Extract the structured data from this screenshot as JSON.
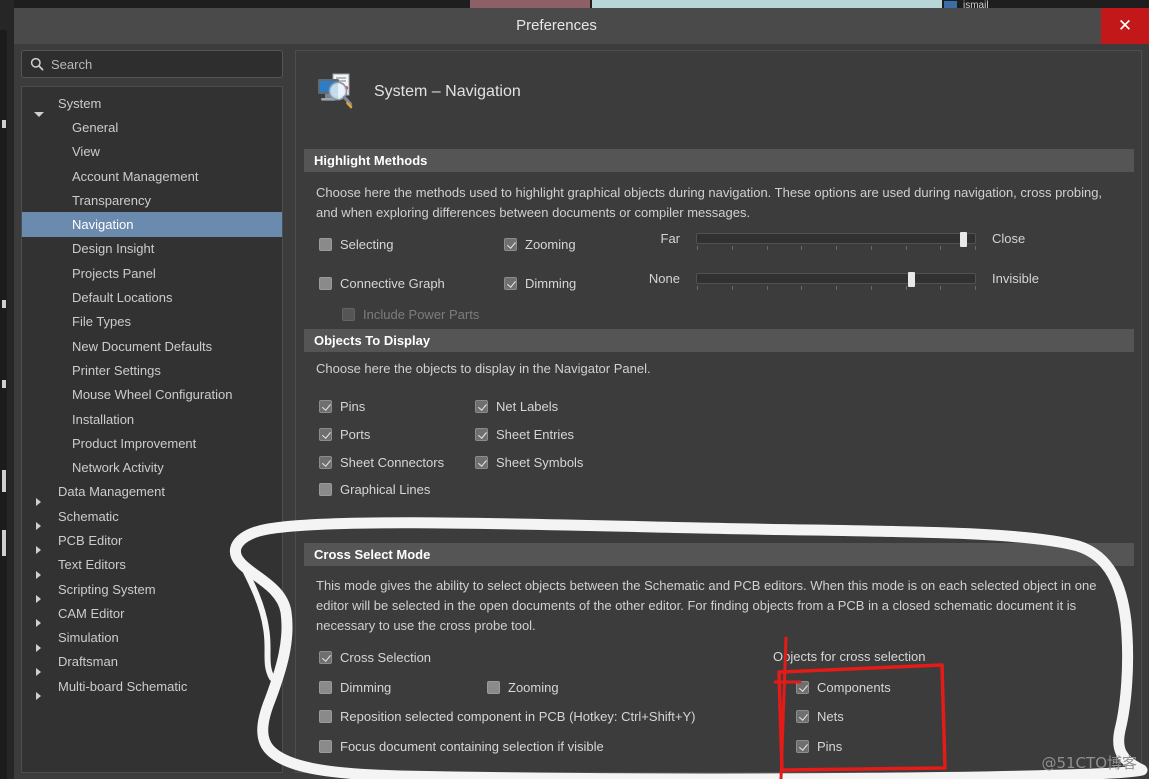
{
  "window": {
    "title": "Preferences",
    "close_label": "✕",
    "close_color": "#c2181a",
    "background_app_text": "ismail"
  },
  "search": {
    "icon": "search-icon",
    "placeholder": "Search",
    "value": ""
  },
  "sidebar": {
    "items": [
      {
        "label": "System",
        "level": 0,
        "expanded": true,
        "selected": false
      },
      {
        "label": "General",
        "level": 1,
        "expanded": false,
        "selected": false
      },
      {
        "label": "View",
        "level": 1,
        "expanded": false,
        "selected": false
      },
      {
        "label": "Account Management",
        "level": 1,
        "expanded": false,
        "selected": false
      },
      {
        "label": "Transparency",
        "level": 1,
        "expanded": false,
        "selected": false
      },
      {
        "label": "Navigation",
        "level": 1,
        "expanded": false,
        "selected": true
      },
      {
        "label": "Design Insight",
        "level": 1,
        "expanded": false,
        "selected": false
      },
      {
        "label": "Projects Panel",
        "level": 1,
        "expanded": false,
        "selected": false
      },
      {
        "label": "Default Locations",
        "level": 1,
        "expanded": false,
        "selected": false
      },
      {
        "label": "File Types",
        "level": 1,
        "expanded": false,
        "selected": false
      },
      {
        "label": "New Document Defaults",
        "level": 1,
        "expanded": false,
        "selected": false
      },
      {
        "label": "Printer Settings",
        "level": 1,
        "expanded": false,
        "selected": false
      },
      {
        "label": "Mouse Wheel Configuration",
        "level": 1,
        "expanded": false,
        "selected": false
      },
      {
        "label": "Installation",
        "level": 1,
        "expanded": false,
        "selected": false
      },
      {
        "label": "Product Improvement",
        "level": 1,
        "expanded": false,
        "selected": false
      },
      {
        "label": "Network Activity",
        "level": 1,
        "expanded": false,
        "selected": false
      },
      {
        "label": "Data Management",
        "level": 0,
        "expanded": false,
        "selected": false
      },
      {
        "label": "Schematic",
        "level": 0,
        "expanded": false,
        "selected": false
      },
      {
        "label": "PCB Editor",
        "level": 0,
        "expanded": false,
        "selected": false
      },
      {
        "label": "Text Editors",
        "level": 0,
        "expanded": false,
        "selected": false
      },
      {
        "label": "Scripting System",
        "level": 0,
        "expanded": false,
        "selected": false
      },
      {
        "label": "CAM Editor",
        "level": 0,
        "expanded": false,
        "selected": false
      },
      {
        "label": "Simulation",
        "level": 0,
        "expanded": false,
        "selected": false
      },
      {
        "label": "Draftsman",
        "level": 0,
        "expanded": false,
        "selected": false
      },
      {
        "label": "Multi-board Schematic",
        "level": 0,
        "expanded": false,
        "selected": false
      }
    ]
  },
  "page": {
    "icon": "system-navigation-icon",
    "title": "System – Navigation"
  },
  "highlight_methods": {
    "header": "Highlight Methods",
    "description": "Choose here the methods used to highlight graphical objects during navigation. These options are used during navigation, cross probing, and when exploring differences between documents or compiler messages.",
    "checkboxes": [
      {
        "label": "Selecting",
        "checked": false,
        "disabled": false
      },
      {
        "label": "Zooming",
        "checked": true,
        "disabled": false
      },
      {
        "label": "Connective Graph",
        "checked": false,
        "disabled": false
      },
      {
        "label": "Dimming",
        "checked": true,
        "disabled": false
      },
      {
        "label": "Include Power Parts",
        "checked": false,
        "disabled": true
      }
    ],
    "sliders": [
      {
        "name": "zoom-slider",
        "left_label": "Far",
        "right_label": "Close",
        "value_pct": 97,
        "ticks": 9
      },
      {
        "name": "dimming-slider",
        "left_label": "None",
        "right_label": "Invisible",
        "value_pct": 78,
        "ticks": 9
      }
    ]
  },
  "objects_to_display": {
    "header": "Objects To Display",
    "description": "Choose here the objects to display in the Navigator Panel.",
    "left_column": [
      {
        "label": "Pins",
        "checked": true
      },
      {
        "label": "Ports",
        "checked": true
      },
      {
        "label": "Sheet Connectors",
        "checked": true
      },
      {
        "label": "Graphical Lines",
        "checked": false
      }
    ],
    "right_column": [
      {
        "label": "Net Labels",
        "checked": true
      },
      {
        "label": "Sheet Entries",
        "checked": true
      },
      {
        "label": "Sheet Symbols",
        "checked": true
      }
    ]
  },
  "cross_select_mode": {
    "header": "Cross Select Mode",
    "description": "This mode gives the ability to select objects between the Schematic and PCB editors.  When this mode is on each selected object in one editor will be selected in the open documents of the other editor.  For finding objects from a PCB in a closed schematic document it is necessary to use the cross probe tool.",
    "checkboxes": [
      {
        "label": "Cross Selection",
        "checked": true
      },
      {
        "label": "Dimming",
        "checked": false
      },
      {
        "label": "Zooming",
        "checked": false
      },
      {
        "label": "Reposition selected component in PCB (Hotkey: Ctrl+Shift+Y)",
        "checked": false
      },
      {
        "label": "Focus document containing selection if visible",
        "checked": false
      }
    ],
    "objects_group_label": "Objects for cross selection",
    "objects": [
      {
        "label": "Components",
        "checked": true
      },
      {
        "label": "Nets",
        "checked": true
      },
      {
        "label": "Pins",
        "checked": true
      }
    ]
  },
  "annotations": {
    "white_highlight_color": "#f2f2f2",
    "red_box_color": "#e41b17",
    "watermark": "@51CTO博客"
  }
}
